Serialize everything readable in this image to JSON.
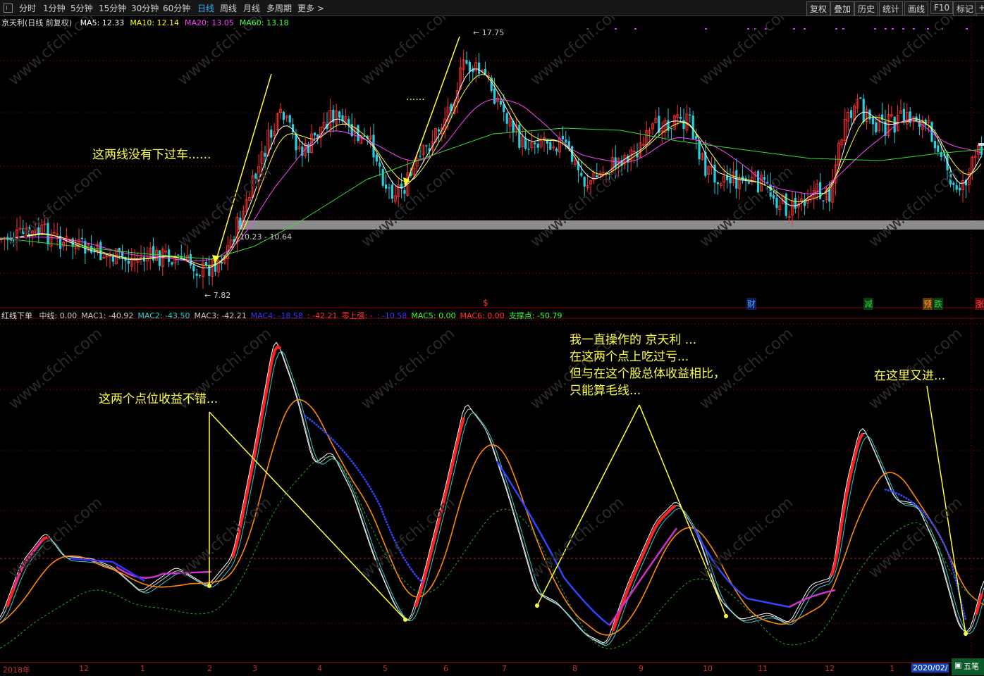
{
  "toolbar": {
    "items": [
      "分时",
      "1分钟",
      "5分钟",
      "15分钟",
      "30分钟",
      "60分钟",
      "日线",
      "周线",
      "月线",
      "多周期",
      "更多 >"
    ],
    "active_index": 6,
    "right_items": [
      "复权",
      "叠加",
      "历史",
      "统计",
      "画线",
      "F10",
      "标记",
      "+"
    ]
  },
  "main_panel": {
    "stock_label": "京天利(日线 前复权)",
    "ma": [
      {
        "text": "MA5: 12.33",
        "color": "#ffffff"
      },
      {
        "text": "MA10: 12.14",
        "color": "#ffff00"
      },
      {
        "text": "MA20: 13.05",
        "color": "#ff44ff"
      },
      {
        "text": "MA60: 13.18",
        "color": "#44ff44"
      }
    ],
    "high_label": "17.75",
    "low_label": "7.82",
    "range_label": "10.23 - 10.64",
    "signals": [
      {
        "text": "$",
        "color": "#ff3333"
      },
      {
        "text": "财",
        "color": "#3388ff"
      },
      {
        "text": "减",
        "color": "#33cc33"
      },
      {
        "text": "预",
        "color": "#ff8800"
      },
      {
        "text": "跌",
        "color": "#33cc33"
      },
      {
        "text": "涨",
        "color": "#ff3333"
      }
    ]
  },
  "indicator_panel": {
    "name": "红线下单",
    "items": [
      {
        "text": "中线: 0.00",
        "color": "#cccccc"
      },
      {
        "text": "MAC1: -40.92",
        "color": "#cccccc"
      },
      {
        "text": "MAC2: -43.50",
        "color": "#33cccc"
      },
      {
        "text": "MAC3: -42.21",
        "color": "#cccccc"
      },
      {
        "text": "MAC4: -18.58",
        "color": "#3333ff"
      },
      {
        "text": ": -42.21",
        "color": "#ff3333"
      },
      {
        "text": "零上强: -",
        "color": "#ff3333"
      },
      {
        "text": ": -10.58",
        "color": "#3333ff"
      },
      {
        "text": "MAC5: 0.00",
        "color": "#33ff33"
      },
      {
        "text": "MAC6: 0.00",
        "color": "#ff3333"
      },
      {
        "text": "支撑点: -50.79",
        "color": "#33ff33"
      }
    ]
  },
  "annotations": {
    "a1": "这两线没有下过车......",
    "a2": "这两个点位收益不错...",
    "a3": [
      "我一直操作的 京天利 ...",
      "在这两个点上吃过亏...",
      "但与在这个股总体收益相比，",
      "只能算毛线..."
    ],
    "a4": "在这里又进...",
    "dots": "......"
  },
  "date_axis": {
    "labels": [
      "2018年",
      "12",
      "1",
      "2",
      "3",
      "4",
      "5",
      "6",
      "7",
      "8",
      "9",
      "10",
      "11",
      "12",
      "1"
    ],
    "current": "2020/02/",
    "five_button": "五笔"
  },
  "watermark": "www.cfchi.com",
  "chart_data": {
    "type": "candlestick+line",
    "title": "京天利(日线 前复权)",
    "series": [
      {
        "name": "MA5",
        "last": 12.33
      },
      {
        "name": "MA10",
        "last": 12.14
      },
      {
        "name": "MA20",
        "last": 13.05
      },
      {
        "name": "MA60",
        "last": 13.18
      }
    ],
    "price_high": 17.75,
    "price_low": 7.82,
    "range_band": [
      10.23,
      10.64
    ],
    "months": [
      "2018年",
      "12",
      "1",
      "2",
      "3",
      "4",
      "5",
      "6",
      "7",
      "8",
      "9",
      "10",
      "11",
      "12",
      "1",
      "2020/02/"
    ],
    "indicator": {
      "name": "红线下单",
      "values": {
        "中线": 0.0,
        "MAC1": -40.92,
        "MAC2": -43.5,
        "MAC3": -42.21,
        "MAC4": -18.58,
        "MAC5": 0.0,
        "MAC6": 0.0,
        "支撑点": -50.79
      }
    }
  }
}
